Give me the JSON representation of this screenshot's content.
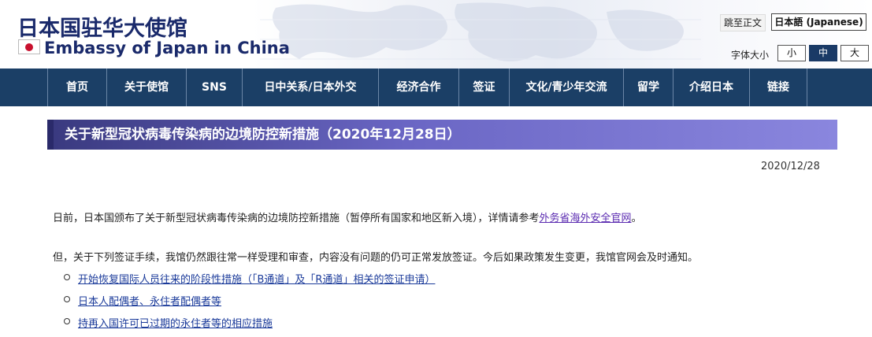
{
  "header": {
    "title_cn": "日本国驻华大使馆",
    "title_en": "Embassy of Japan in China",
    "skip_label": "跳至正文",
    "lang_label": "日本語 (Japanese)",
    "font_size_label": "字体大小",
    "font_sizes": [
      "小",
      "中",
      "大"
    ],
    "font_size_selected": "中"
  },
  "nav": {
    "items": [
      "首页",
      "关于使馆",
      "SNS",
      "日中关系/日本外交",
      "经济合作",
      "签证",
      "文化/青少年交流",
      "留学",
      "介绍日本",
      "链接"
    ]
  },
  "article": {
    "title": "关于新型冠状病毒传染病的边境防控新措施（2020年12月28日）",
    "date": "2020/12/28",
    "para1_text": "日前，日本国颁布了关于新型冠状病毒传染病的边境防控新措施（暂停所有国家和地区新入境），详情请参考",
    "para1_link": "外务省海外安全官网",
    "para1_end": "。",
    "para2_text": "但，关于下列签证手续，我馆仍然跟往常一样受理和审查，内容没有问题的仍可正常发放签证。今后如果政策发生变更，我馆官网会及时通知。",
    "list": [
      "开始恢复国际人员往来的阶段性措施（「B通道」及「R通道」相关的签证申请）",
      "日本人配偶者、永住者配偶者等",
      "持再入国许可已过期的永住者等的相应措施"
    ]
  },
  "colors": {
    "nav_bg": "#1b3f66",
    "title_navy": "#1a2a6b",
    "title_bar_start": "#3a3a80",
    "title_bar_end": "#8a86de"
  }
}
